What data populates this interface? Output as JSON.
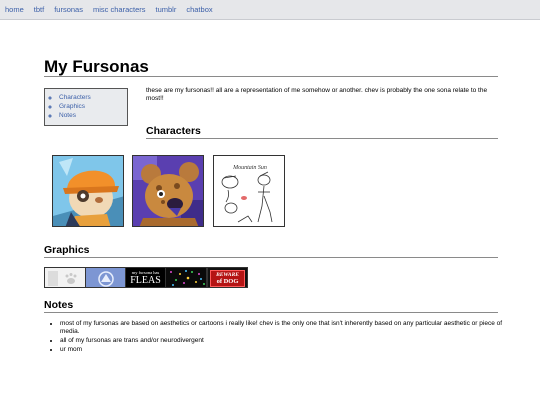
{
  "nav": {
    "items": [
      {
        "label": "home"
      },
      {
        "label": "tbtf"
      },
      {
        "label": "fursonas"
      },
      {
        "label": "misc characters"
      },
      {
        "label": "tumblr"
      },
      {
        "label": "chatbox"
      }
    ]
  },
  "page": {
    "title": "My Fursonas",
    "intro": "these are my fursonas!! all are a representation of me somehow or another. chev is probably the one sona relate to the most!!"
  },
  "toc": {
    "items": [
      {
        "label": "Characters"
      },
      {
        "label": "Graphics"
      },
      {
        "label": "Notes"
      }
    ]
  },
  "sections": {
    "characters": {
      "heading": "Characters"
    },
    "graphics": {
      "heading": "Graphics"
    },
    "notes": {
      "heading": "Notes"
    }
  },
  "sketch": {
    "caption": "Mountain Sun"
  },
  "graphics": {
    "buttons": [
      {
        "name": "paw-print-button"
      },
      {
        "name": "circle-badge-button"
      },
      {
        "text_top": "my fursona has",
        "text_main": "FLEAS"
      },
      {
        "name": "sparkle-noise-button"
      },
      {
        "text_top": "BEWARE",
        "text_main": "of DOG"
      }
    ]
  },
  "notes": {
    "items": [
      {
        "text": "most of my fursonas are based on aesthetics or cartoons i really like! chev is the only one that isn't inherently based on any particular aesthetic or piece of media."
      },
      {
        "text": "all of my fursonas are trans and/or neurodivergent"
      },
      {
        "text": "ur mom"
      }
    ]
  },
  "colors": {
    "link": "#3b5fa8",
    "nav_bg": "#e6e7ea",
    "toc_bg": "#e9ebee"
  }
}
